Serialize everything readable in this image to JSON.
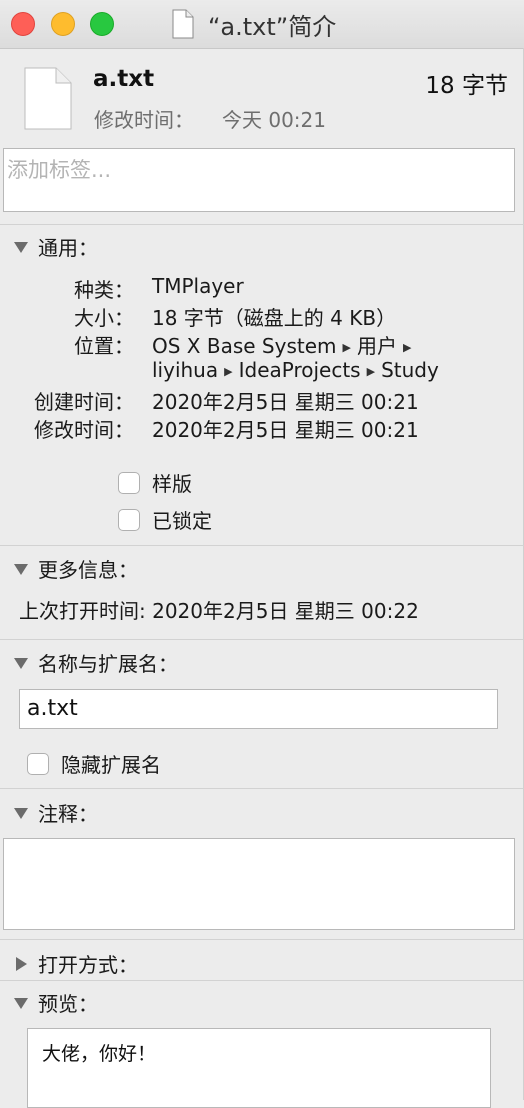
{
  "window": {
    "title": "“a.txt”简介"
  },
  "header": {
    "filename": "a.txt",
    "size": "18 字节",
    "modified_label": "修改时间：",
    "modified_value": "今天 00:21"
  },
  "tags": {
    "placeholder": "添加标签..."
  },
  "general": {
    "title": "通用：",
    "kind_label": "种类：",
    "kind_value": "TMPlayer",
    "size_label": "大小：",
    "size_value": "18 字节（磁盘上的 4 KB）",
    "where_label": "位置：",
    "where_path_1": [
      "OS X Base System",
      "用户"
    ],
    "where_path_2": [
      "liyihua",
      "IdeaProjects",
      "Study"
    ],
    "created_label": "创建时间：",
    "created_value": "2020年2月5日 星期三 00:21",
    "modified_label": "修改时间：",
    "modified_value": "2020年2月5日 星期三 00:21",
    "stationery_label": "样版",
    "locked_label": "已锁定"
  },
  "more_info": {
    "title": "更多信息：",
    "last_opened": "上次打开时间: 2020年2月5日 星期三 00:22"
  },
  "name_ext": {
    "title": "名称与扩展名：",
    "value": "a.txt",
    "hide_ext_label": "隐藏扩展名"
  },
  "comments": {
    "title": "注释："
  },
  "open_with": {
    "title": "打开方式："
  },
  "preview": {
    "title": "预览：",
    "content": "大佬，你好！"
  }
}
